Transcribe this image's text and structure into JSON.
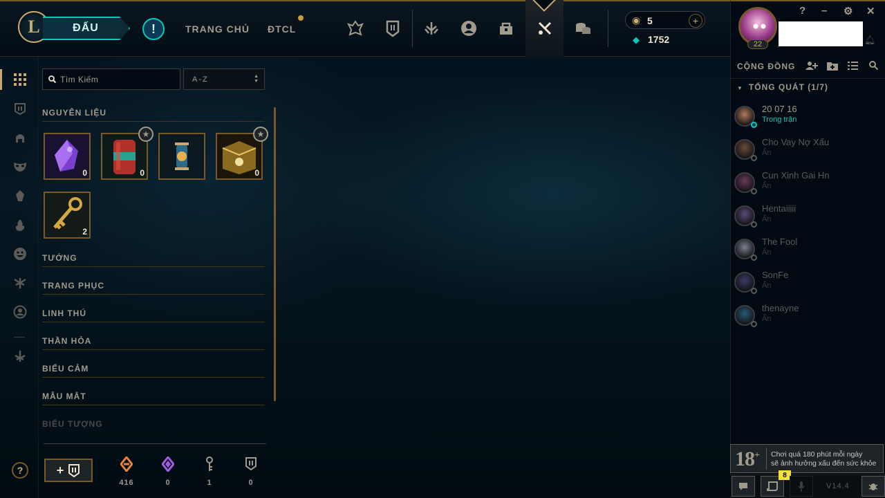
{
  "header": {
    "logo": "L",
    "play_label": "ĐẤU",
    "alert_label": "!",
    "nav_home": "TRANG CHỦ",
    "nav_tft": "ĐTCL",
    "rp_value": "5",
    "be_value": "1752",
    "rp_plus": "+"
  },
  "profile": {
    "level": "22",
    "window_controls": [
      "?",
      "–",
      "⚙",
      "✕"
    ]
  },
  "loot": {
    "search_placeholder": "Tìm Kiếm",
    "sort_value": "A-Z",
    "categories": {
      "materials": "NGUYÊN LIỆU",
      "champions": "TƯỚNG",
      "skins": "TRANG PHỤC",
      "companions": "LINH THÚ",
      "ward_skins": "THẦN HỎA",
      "emotes": "BIỂU CẢM",
      "eye_colors": "MẪU MẮT",
      "icons": "BIỂU TƯỢNG"
    },
    "items": [
      {
        "name": "purple-gem",
        "count": "0",
        "star": false
      },
      {
        "name": "red-capsule",
        "count": "0",
        "star": true
      },
      {
        "name": "orb-capsule",
        "count": "",
        "star": false
      },
      {
        "name": "hextech-chest",
        "count": "0",
        "star": true
      },
      {
        "name": "key",
        "count": "2",
        "star": false
      }
    ],
    "materials": [
      {
        "icon": "orange-essence-icon",
        "value": "416",
        "color": "#e8853a"
      },
      {
        "icon": "mythic-essence-icon",
        "value": "0",
        "color": "#a45ee5"
      },
      {
        "icon": "key-fragment-icon",
        "value": "1",
        "color": "#a09b8c"
      },
      {
        "icon": "chest-icon",
        "value": "0",
        "color": "#a09b8c"
      }
    ],
    "craft_label": "+"
  },
  "social": {
    "title": "CỘNG ĐỒNG",
    "group": "TỔNG QUÁT (1/7)",
    "friends": [
      {
        "name": "20 07 16",
        "status": "Trong trận",
        "online": true,
        "color": "#b07a5a"
      },
      {
        "name": "Cho Vay Nợ Xấu",
        "status": "Ẩn",
        "online": false,
        "color": "#6a4a3a"
      },
      {
        "name": "Cun Xinh Gai Hn",
        "status": "Ẩn",
        "online": false,
        "color": "#6a3a5a"
      },
      {
        "name": "Hentaiiiii",
        "status": "Ẩn",
        "online": false,
        "color": "#5a4a7a"
      },
      {
        "name": "The Fool",
        "status": "Ẩn",
        "online": false,
        "color": "#7a8090"
      },
      {
        "name": "SonFe",
        "status": "Ẩn",
        "online": false,
        "color": "#3a3a6a"
      },
      {
        "name": "thenayne",
        "status": "Ẩn",
        "online": false,
        "color": "#2a5a7a"
      }
    ]
  },
  "warning": {
    "age": "18",
    "plus": "+",
    "line1": "Chơi quá 180 phút mỗi ngày",
    "line2": "sẽ ảnh hưởng xấu đến sức khỏe"
  },
  "footer": {
    "badge": "8",
    "version": "V14.4"
  },
  "colors": {
    "gold": "#c8aa6e",
    "teal": "#0ac8b9",
    "background": "#010a13"
  }
}
